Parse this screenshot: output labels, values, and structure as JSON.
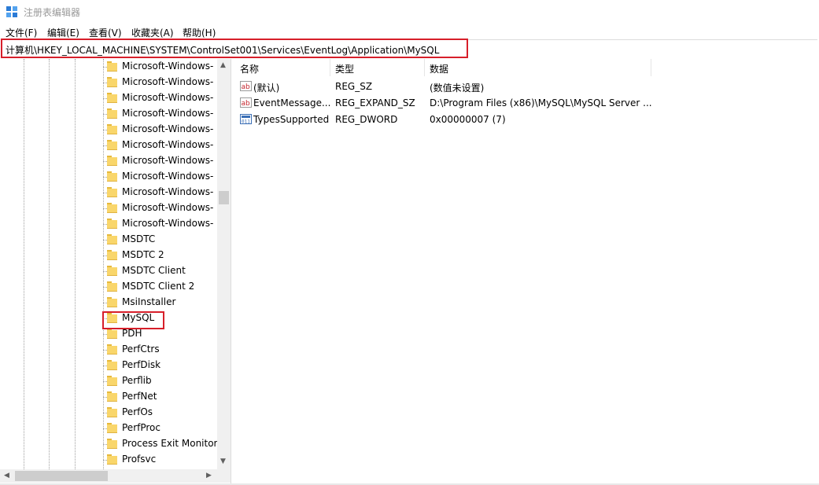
{
  "window": {
    "title": "注册表编辑器"
  },
  "menu": [
    "文件(F)",
    "编辑(E)",
    "查看(V)",
    "收藏夹(A)",
    "帮助(H)"
  ],
  "address": {
    "path": "计算机\\HKEY_LOCAL_MACHINE\\SYSTEM\\ControlSet001\\Services\\EventLog\\Application\\MySQL"
  },
  "tree": {
    "items": [
      "Microsoft-Windows-",
      "Microsoft-Windows-",
      "Microsoft-Windows-",
      "Microsoft-Windows-",
      "Microsoft-Windows-",
      "Microsoft-Windows-",
      "Microsoft-Windows-",
      "Microsoft-Windows-",
      "Microsoft-Windows-",
      "Microsoft-Windows-",
      "Microsoft-Windows-",
      "MSDTC",
      "MSDTC 2",
      "MSDTC Client",
      "MSDTC Client 2",
      "MsiInstaller",
      "MySQL",
      "PDH",
      "PerfCtrs",
      "PerfDisk",
      "Perflib",
      "PerfNet",
      "PerfOs",
      "PerfProc",
      "Process Exit Monitor",
      "Profsvc"
    ],
    "selected": "MySQL"
  },
  "values": {
    "headers": {
      "name": "名称",
      "type": "类型",
      "data": "数据"
    },
    "rows": [
      {
        "icon": "string-value-icon",
        "name": "(默认)",
        "type": "REG_SZ",
        "data": "(数值未设置)"
      },
      {
        "icon": "string-value-icon",
        "name": "EventMessage...",
        "type": "REG_EXPAND_SZ",
        "data": "D:\\Program Files (x86)\\MySQL\\MySQL Server ..."
      },
      {
        "icon": "binary-value-icon",
        "name": "TypesSupported",
        "type": "REG_DWORD",
        "data": "0x00000007 (7)"
      }
    ]
  },
  "colors": {
    "highlight": "#d71f2a",
    "folder": "#f9d66b"
  }
}
